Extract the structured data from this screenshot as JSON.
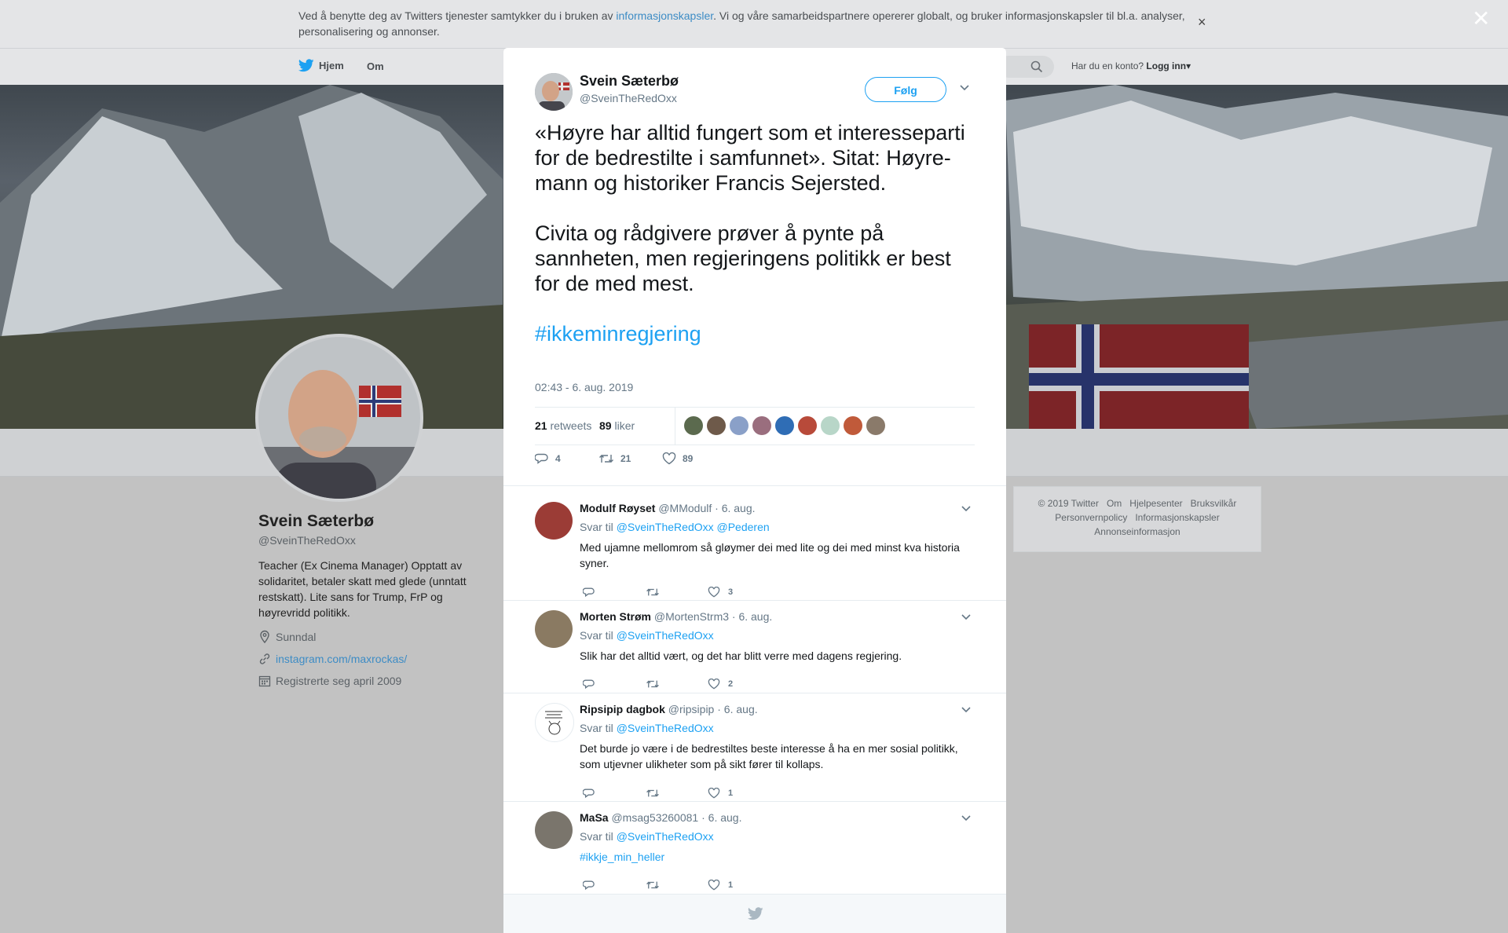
{
  "cookie": {
    "text_before": "Ved å benytte deg av Twitters tjenester samtykker du i bruken av ",
    "link": "informasjonskapsler",
    "text_after": ". Vi og våre samarbeidspartnere opererer globalt, og bruker informasjonskapsler til bl.a. analyser, personalisering og annonser.",
    "close": "×"
  },
  "topnav": {
    "home": "Hjem",
    "about": "Om",
    "have_account": "Har du en konto?",
    "login": "Logg inn",
    "login_caret": "▾"
  },
  "overlay_close": "✕",
  "profile": {
    "name": "Svein Sæterbø",
    "handle": "@SveinTheRedOxx",
    "bio": "Teacher (Ex Cinema Manager) Opptatt av solidaritet, betaler skatt med glede (unntatt restskatt). Lite sans for Trump, FrP og høyrevridd politikk.",
    "location": "Sunndal",
    "website": "instagram.com/maxrockas/",
    "joined": "Registrerte seg april 2009"
  },
  "footer": {
    "row1": [
      "© 2019 Twitter",
      "Om",
      "Hjelpesenter",
      "Bruksvilkår"
    ],
    "row2": [
      "Personvernpolicy",
      "Informasjonskapsler"
    ],
    "row3": [
      "Annonseinformasjon"
    ]
  },
  "tweet": {
    "name": "Svein Sæterbø",
    "handle": "@SveinTheRedOxx",
    "follow": "Følg",
    "para1": "«Høyre har alltid fungert som et interesseparti for de bedrestilte i samfunnet». Sitat: Høyre-mann og historiker Francis Sejersted.",
    "para2": "Civita og rådgivere prøver å pynte på sannheten, men regjeringens politikk er best for de med mest.",
    "hashtag": "#ikkeminregjering",
    "time": "02:43 - 6. aug. 2019",
    "retweets_count": "21",
    "retweets_label": "retweets",
    "likes_count": "89",
    "likes_label": "liker",
    "replies_action": "4",
    "retweets_action": "21",
    "likes_action": "89",
    "liker_colors": [
      "#5b6a4e",
      "#6e5a4a",
      "#8aa0c8",
      "#9a6e7e",
      "#2f6db5",
      "#b84a3a",
      "#b8d6c8",
      "#c05a3a",
      "#8a7a6a"
    ]
  },
  "replies": [
    {
      "name": "Modulf Røyset",
      "handle": "@MModulf",
      "date": "· 6. aug.",
      "to_label": "Svar til",
      "mentions": "@SveinTheRedOxx @Pederen",
      "text": "Med ujamne mellomrom så gløymer dei med lite og dei med minst kva historia syner.",
      "likes": "3",
      "avatar_color": "#a4403a"
    },
    {
      "name": "Morten Strøm",
      "handle": "@MortenStrm3",
      "date": "· 6. aug.",
      "to_label": "Svar til",
      "mentions": "@SveinTheRedOxx",
      "text": "Slik har det alltid vært, og det har blitt verre med dagens regjering.",
      "likes": "2",
      "avatar_color": "#8a7a62"
    },
    {
      "name": "Ripsipip dagbok",
      "handle": "@ripsipip",
      "date": "· 6. aug.",
      "to_label": "Svar til",
      "mentions": "@SveinTheRedOxx",
      "text": "Det burde jo være i de bedrestiltes beste interesse å ha en mer sosial politikk, som utjevner ulikheter som på sikt fører til kollaps.",
      "likes": "1",
      "avatar_color": "#ffffff"
    },
    {
      "name": "MaSa",
      "handle": "@msag53260081",
      "date": "· 6. aug.",
      "to_label": "Svar til",
      "mentions": "@SveinTheRedOxx",
      "text": "#ikkje_min_heller",
      "likes": "1",
      "avatar_color": "#7a756c"
    }
  ]
}
